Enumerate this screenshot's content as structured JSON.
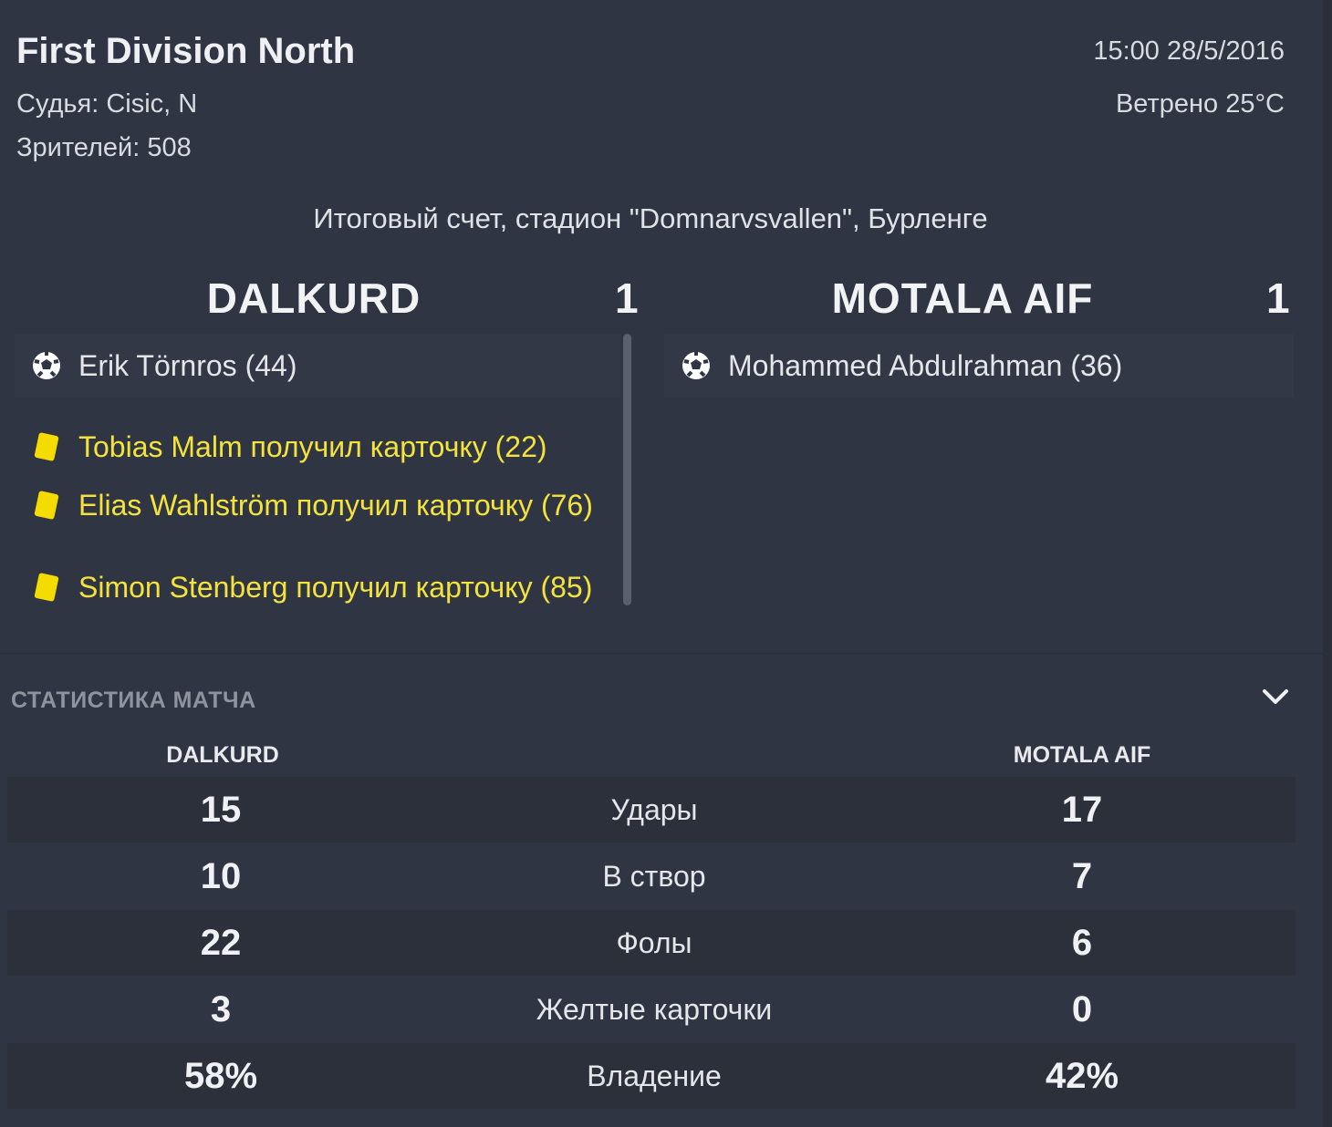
{
  "header": {
    "competition": "First Division North",
    "referee": "Судья: Cisic, N",
    "attendance": "Зрителей: 508",
    "datetime": "15:00 28/5/2016",
    "weather": "Ветрено 25°C",
    "venue": "Итоговый счет, стадион \"Domnarvsvallen\", Бурленге"
  },
  "home": {
    "name": "DALKURD",
    "score": "1",
    "events": [
      {
        "type": "goal",
        "text": "Erik Törnros (44)"
      },
      {
        "type": "yellow",
        "text": "Tobias Malm получил карточку (22)"
      },
      {
        "type": "yellow",
        "text": "Elias Wahlström получил карточку (76)"
      },
      {
        "type": "yellow",
        "text": "Simon Stenberg получил карточку (85)"
      }
    ]
  },
  "away": {
    "name": "MOTALA AIF",
    "score": "1",
    "events": [
      {
        "type": "goal",
        "text": "Mohammed Abdulrahman (36)"
      }
    ]
  },
  "stats": {
    "title": "СТАТИСТИКА МАТЧА",
    "home_header": "DALKURD",
    "away_header": "MOTALA AIF",
    "rows": [
      {
        "label": "Удары",
        "home": "15",
        "away": "17"
      },
      {
        "label": "В створ",
        "home": "10",
        "away": "7"
      },
      {
        "label": "Фолы",
        "home": "22",
        "away": "6"
      },
      {
        "label": "Желтые карточки",
        "home": "3",
        "away": "0"
      },
      {
        "label": "Владение",
        "home": "58%",
        "away": "42%"
      }
    ]
  },
  "icons": {
    "goal": "football-icon",
    "yellow": "yellow-card-icon",
    "collapse": "chevron-down-icon"
  },
  "colors": {
    "background": "#2f3542",
    "yellow_card": "#f5dc00",
    "yellow_text": "#f3e33c"
  }
}
